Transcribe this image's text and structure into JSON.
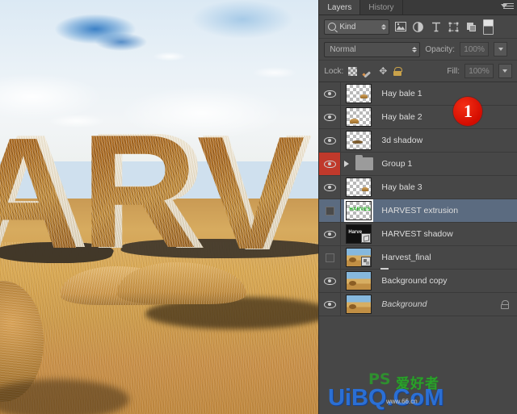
{
  "canvas": {
    "name": "document-canvas",
    "scene_text": "ARV",
    "description": "Hay-textured 3D letters on a harvested straw field under a cloudy blue sky"
  },
  "panel": {
    "tabs": [
      {
        "label": "Layers",
        "active": true
      },
      {
        "label": "History",
        "active": false
      }
    ],
    "menu_icon": "panel-menu-icon",
    "filter": {
      "kind_label": "Kind",
      "search_icon": "search-icon",
      "icons": [
        {
          "name": "filter-pixel-icon",
          "glyph": "⛰"
        },
        {
          "name": "filter-adjustment-icon",
          "glyph": "◑"
        },
        {
          "name": "filter-type-icon",
          "glyph": "T"
        },
        {
          "name": "filter-shape-icon",
          "glyph": "⬚"
        },
        {
          "name": "filter-smart-object-icon",
          "glyph": "❐"
        }
      ],
      "toggle_name": "filter-enable-toggle"
    },
    "blend": {
      "mode": "Normal",
      "opacity_label": "Opacity:",
      "opacity_value": "100%"
    },
    "lock": {
      "label": "Lock:",
      "items": [
        "lock-transparent-pixels",
        "lock-image-pixels",
        "lock-position",
        "lock-all"
      ],
      "fill_label": "Fill:",
      "fill_value": "100%"
    },
    "layers": [
      {
        "name": "Hay bale 1",
        "visible": true,
        "selected": false,
        "type": "pixel",
        "thumb": "transparent-bale",
        "locked": false,
        "eye_highlight": false
      },
      {
        "name": "Hay bale 2",
        "visible": true,
        "selected": false,
        "type": "pixel",
        "thumb": "transparent-bale",
        "locked": false,
        "eye_highlight": false
      },
      {
        "name": "3d shadow",
        "visible": true,
        "selected": false,
        "type": "pixel",
        "thumb": "transparent-shadow",
        "locked": false,
        "eye_highlight": false
      },
      {
        "name": "Group 1",
        "visible": true,
        "selected": false,
        "type": "group",
        "thumb": "folder",
        "locked": false,
        "eye_highlight": true
      },
      {
        "name": "Hay bale 3",
        "visible": true,
        "selected": false,
        "type": "pixel",
        "thumb": "transparent-bale",
        "locked": false,
        "eye_highlight": false
      },
      {
        "name": "HARVEST extrusion",
        "visible": false,
        "selected": true,
        "type": "3d",
        "thumb": "green-text",
        "locked": false,
        "eye_highlight": false
      },
      {
        "name": "HARVEST shadow",
        "visible": true,
        "selected": false,
        "type": "3d",
        "thumb": "dark-text-3d",
        "locked": false,
        "eye_highlight": false
      },
      {
        "name": "Harvest_final",
        "visible": false,
        "selected": false,
        "type": "smart",
        "thumb": "photo-smart",
        "locked": false,
        "eye_highlight": false
      },
      {
        "name": "Background copy",
        "visible": true,
        "selected": false,
        "type": "pixel",
        "thumb": "photo",
        "locked": false,
        "eye_highlight": false
      },
      {
        "name": "Background",
        "visible": true,
        "selected": false,
        "type": "pixel",
        "thumb": "photo",
        "locked": true,
        "eye_highlight": false,
        "italic": true
      }
    ]
  },
  "annotation": {
    "badge_number": "1",
    "badge_color": "#e01000"
  },
  "watermark": {
    "site": "UiBQ.CoM",
    "cn_text": "爱好者",
    "ps_text": "PS",
    "www": "www.66.cn"
  },
  "colors": {
    "panel_bg": "#474747",
    "row_selected": "#5b6b80",
    "eye_highlight": "#c0392b",
    "text": "#dcdcdc",
    "accent_blue": "#2b6fd4",
    "accent_green": "#2aa02a"
  }
}
